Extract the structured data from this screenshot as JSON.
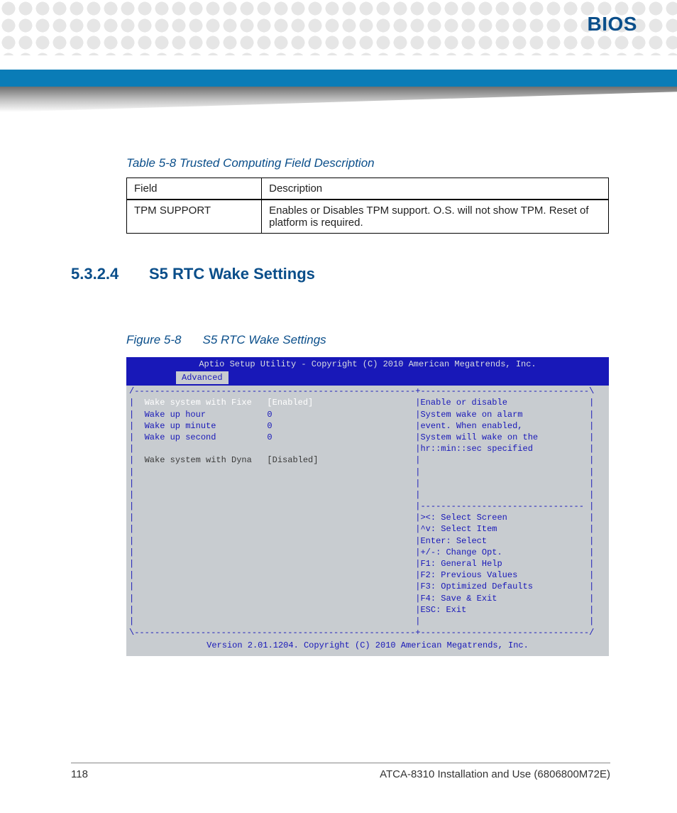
{
  "header": {
    "title": "BIOS"
  },
  "table_caption": "Table 5-8 Trusted Computing Field Description",
  "table": {
    "headers": [
      "Field",
      "Description"
    ],
    "rows": [
      {
        "field": "TPM SUPPORT",
        "description": "Enables or Disables TPM support. O.S. will not show TPM. Reset of platform is required."
      }
    ]
  },
  "section": {
    "number": "5.3.2.4",
    "title": "S5 RTC Wake Settings"
  },
  "figure_caption": {
    "number": "Figure 5-8",
    "title": "S5 RTC Wake Settings"
  },
  "bios": {
    "top_bar": "Aptio Setup Utility - Copyright (C) 2010 American Megatrends, Inc.",
    "active_tab": "Advanced",
    "settings": [
      {
        "label": "Wake system with Fixe",
        "value": "[Enabled]",
        "selected": true
      },
      {
        "label": "Wake up hour",
        "value": "0"
      },
      {
        "label": "Wake up minute",
        "value": "0"
      },
      {
        "label": "Wake up second",
        "value": "0"
      },
      {
        "label": "",
        "value": ""
      },
      {
        "label": "Wake system with Dyna",
        "value": "[Disabled]",
        "disabled": true
      }
    ],
    "help_text": [
      "Enable or disable",
      "System wake on alarm",
      "event. When enabled,",
      "System will wake on the",
      "hr::min::sec specified"
    ],
    "nav_help": [
      "><: Select Screen",
      "^v: Select Item",
      "Enter: Select",
      "+/-: Change Opt.",
      "F1: General Help",
      "F2: Previous Values",
      "F3: Optimized Defaults",
      "F4: Save & Exit",
      "ESC: Exit"
    ],
    "footer": "Version 2.01.1204. Copyright (C) 2010 American Megatrends, Inc."
  },
  "page_footer": {
    "page_number": "118",
    "doc_title": "ATCA-8310 Installation and Use (6806800M72E)"
  }
}
